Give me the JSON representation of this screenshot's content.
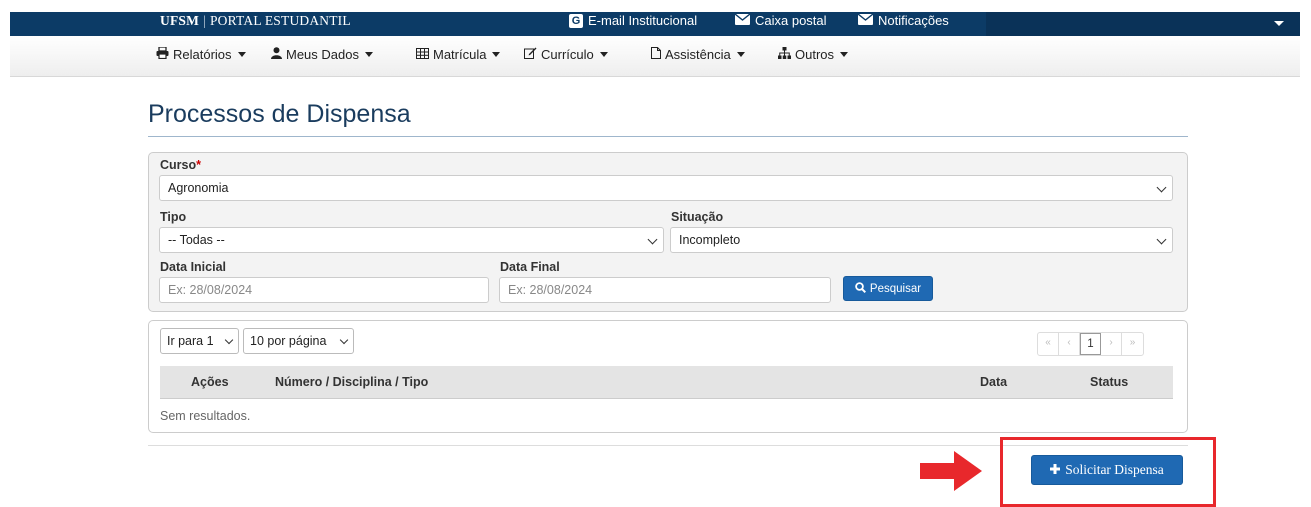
{
  "topbar": {
    "brand_main": "UFSM",
    "brand_sep": "|",
    "brand_sub": "PORTAL ESTUDANTIL",
    "email_badge": "G",
    "email_label": "E-mail Institucional",
    "mailbox_label": "Caixa postal",
    "notifications_label": "Notificações"
  },
  "menu": {
    "items": [
      {
        "label": "Relatórios",
        "icon": "printer-icon"
      },
      {
        "label": "Meus Dados",
        "icon": "user-icon"
      },
      {
        "label": "Matrícula",
        "icon": "table-icon"
      },
      {
        "label": "Currículo",
        "icon": "edit-icon"
      },
      {
        "label": "Assistência",
        "icon": "file-icon"
      },
      {
        "label": "Outros",
        "icon": "sitemap-icon"
      }
    ]
  },
  "page": {
    "title": "Processos de Dispensa"
  },
  "filters": {
    "curso_label": "Curso",
    "curso_required": "*",
    "curso_value": "Agronomia",
    "tipo_label": "Tipo",
    "tipo_value": "-- Todas --",
    "situacao_label": "Situação",
    "situacao_value": "Incompleto",
    "data_inicial_label": "Data Inicial",
    "data_inicial_placeholder": "Ex: 28/08/2024",
    "data_final_label": "Data Final",
    "data_final_placeholder": "Ex: 28/08/2024",
    "search_button": "Pesquisar"
  },
  "results": {
    "goto_page": "Ir para 1",
    "per_page": "10 por página",
    "pager": [
      "«",
      "‹",
      "1",
      "›",
      "»"
    ],
    "columns": [
      "Ações",
      "Número / Disciplina / Tipo",
      "Data",
      "Status"
    ],
    "empty_text": "Sem resultados."
  },
  "actions": {
    "request_button": "Solicitar Dispensa",
    "highlight_color": "#e8282c"
  },
  "colors": {
    "topbar": "#0c3b66",
    "primary_button": "#1f69b3",
    "title": "#1a3c5e"
  }
}
